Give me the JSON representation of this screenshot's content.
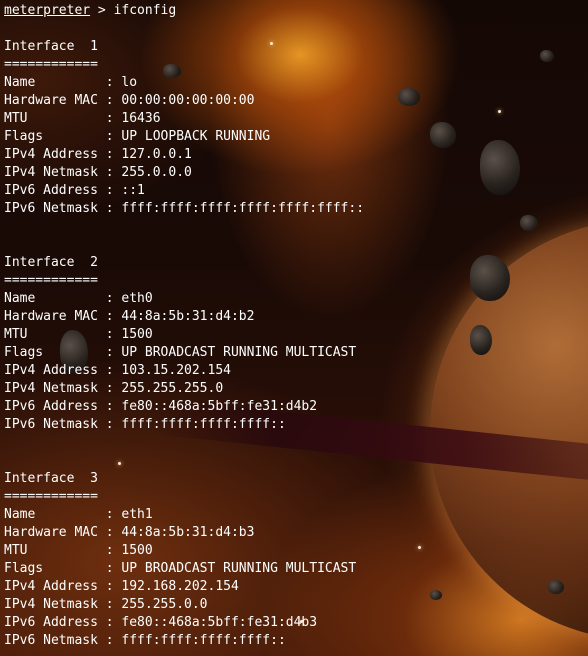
{
  "prompt": {
    "label": "meterpreter",
    "separator": " > ",
    "command": "ifconfig"
  },
  "interfaces": [
    {
      "header": "Interface  1",
      "underline": "============",
      "fields": [
        {
          "key": "Name         ",
          "value": "lo"
        },
        {
          "key": "Hardware MAC ",
          "value": "00:00:00:00:00:00"
        },
        {
          "key": "MTU          ",
          "value": "16436"
        },
        {
          "key": "Flags        ",
          "value": "UP LOOPBACK RUNNING"
        },
        {
          "key": "IPv4 Address ",
          "value": "127.0.0.1"
        },
        {
          "key": "IPv4 Netmask ",
          "value": "255.0.0.0"
        },
        {
          "key": "IPv6 Address ",
          "value": "::1"
        },
        {
          "key": "IPv6 Netmask ",
          "value": "ffff:ffff:ffff:ffff:ffff:ffff::"
        }
      ]
    },
    {
      "header": "Interface  2",
      "underline": "============",
      "fields": [
        {
          "key": "Name         ",
          "value": "eth0"
        },
        {
          "key": "Hardware MAC ",
          "value": "44:8a:5b:31:d4:b2"
        },
        {
          "key": "MTU          ",
          "value": "1500"
        },
        {
          "key": "Flags        ",
          "value": "UP BROADCAST RUNNING MULTICAST"
        },
        {
          "key": "IPv4 Address ",
          "value": "103.15.202.154"
        },
        {
          "key": "IPv4 Netmask ",
          "value": "255.255.255.0"
        },
        {
          "key": "IPv6 Address ",
          "value": "fe80::468a:5bff:fe31:d4b2"
        },
        {
          "key": "IPv6 Netmask ",
          "value": "ffff:ffff:ffff:ffff::"
        }
      ]
    },
    {
      "header": "Interface  3",
      "underline": "============",
      "fields": [
        {
          "key": "Name         ",
          "value": "eth1"
        },
        {
          "key": "Hardware MAC ",
          "value": "44:8a:5b:31:d4:b3"
        },
        {
          "key": "MTU          ",
          "value": "1500"
        },
        {
          "key": "Flags        ",
          "value": "UP BROADCAST RUNNING MULTICAST"
        },
        {
          "key": "IPv4 Address ",
          "value": "192.168.202.154"
        },
        {
          "key": "IPv4 Netmask ",
          "value": "255.255.0.0"
        },
        {
          "key": "IPv6 Address ",
          "value": "fe80::468a:5bff:fe31:d4b3"
        },
        {
          "key": "IPv6 Netmask ",
          "value": "ffff:ffff:ffff:ffff::"
        }
      ]
    }
  ],
  "field_separator": ": ",
  "colors": {
    "text": "#ffffff"
  }
}
